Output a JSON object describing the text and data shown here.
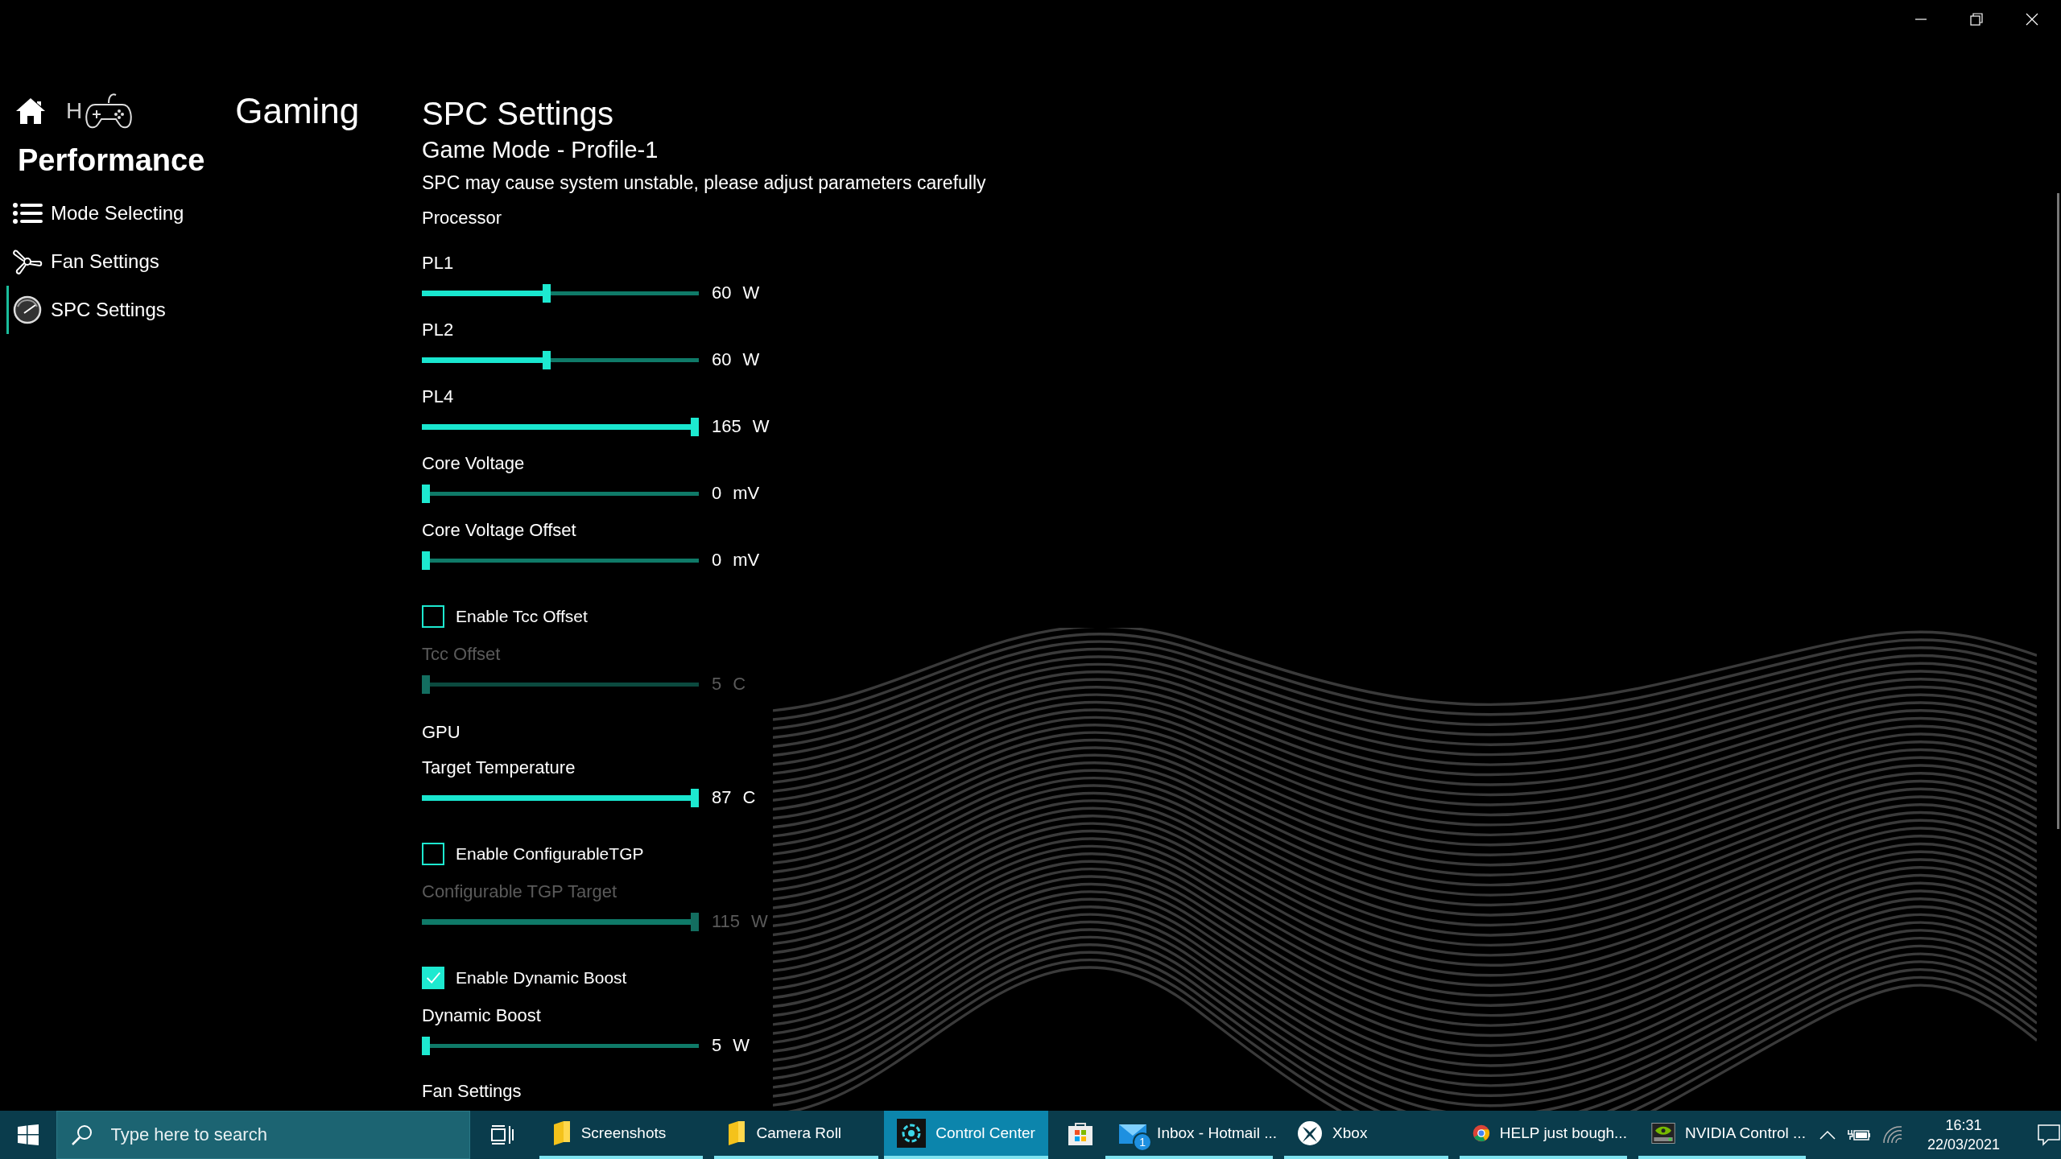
{
  "header": {
    "home_partial": "H",
    "title": "Gaming"
  },
  "sidebar": {
    "title": "Performance",
    "items": [
      {
        "kind": "list",
        "label": "Mode Selecting",
        "selected": false
      },
      {
        "kind": "fan",
        "label": "Fan Settings",
        "selected": false
      },
      {
        "kind": "gauge",
        "label": "SPC Settings",
        "selected": true
      }
    ]
  },
  "content": {
    "title": "SPC Settings",
    "subtitle": "Game Mode - Profile-1",
    "warning": "SPC may cause system unstable, please adjust parameters carefully",
    "sections": [
      {
        "heading": "Processor",
        "items": [
          {
            "kind": "slider",
            "label": "PL1",
            "level": 0.45,
            "value": "60",
            "unit": "W",
            "disabled": false
          },
          {
            "kind": "slider",
            "label": "PL2",
            "level": 0.45,
            "value": "60",
            "unit": "W",
            "disabled": false
          },
          {
            "kind": "slider",
            "label": "PL4",
            "level": 1,
            "value": "165",
            "unit": "W",
            "disabled": false
          },
          {
            "kind": "slider",
            "label": "Core Voltage",
            "level": 0,
            "value": "0",
            "unit": "mV",
            "disabled": false
          },
          {
            "kind": "slider",
            "label": "Core Voltage Offset",
            "level": 0,
            "value": "0",
            "unit": "mV",
            "disabled": false
          },
          {
            "kind": "checkbox",
            "label": "Enable Tcc Offset",
            "checked": false
          },
          {
            "kind": "slider",
            "label": "Tcc Offset",
            "level": 0,
            "value": "5",
            "unit": "C",
            "disabled": true
          }
        ]
      },
      {
        "heading": "GPU",
        "items": [
          {
            "kind": "slider",
            "label": "Target Temperature",
            "level": 1,
            "value": "87",
            "unit": "C",
            "disabled": false
          },
          {
            "kind": "checkbox",
            "label": "Enable ConfigurableTGP",
            "checked": false
          },
          {
            "kind": "slider",
            "label": "Configurable TGP Target",
            "level": 1,
            "value": "115",
            "unit": "W",
            "disabled": true
          },
          {
            "kind": "checkbox",
            "label": "Enable Dynamic Boost",
            "checked": true
          },
          {
            "kind": "slider",
            "label": "Dynamic Boost",
            "level": 0,
            "value": "5",
            "unit": "W",
            "disabled": false
          }
        ]
      },
      {
        "heading": "Fan Settings"
      }
    ]
  },
  "taskbar": {
    "search": {
      "placeholder": "Type here to search"
    },
    "apps": [
      {
        "kind": "folder",
        "label": "Screenshots",
        "running": true,
        "selected": false
      },
      {
        "kind": "folder",
        "label": "Camera Roll",
        "running": true,
        "selected": false
      },
      {
        "kind": "control",
        "label": "Control Center",
        "running": true,
        "selected": true
      },
      {
        "kind": "store",
        "running": false,
        "selected": false
      },
      {
        "kind": "mail",
        "label": "Inbox - Hotmail ...",
        "badge": "1",
        "running": true,
        "selected": false
      },
      {
        "kind": "xbox",
        "label": "Xbox",
        "running": true,
        "selected": false
      },
      {
        "kind": "browser",
        "label": "HELP just bough...",
        "running": true,
        "selected": false
      },
      {
        "kind": "nvidia",
        "label": "NVIDIA Control ...",
        "running": true,
        "selected": false
      }
    ],
    "time": "16:31",
    "date": "22/03/2021"
  }
}
